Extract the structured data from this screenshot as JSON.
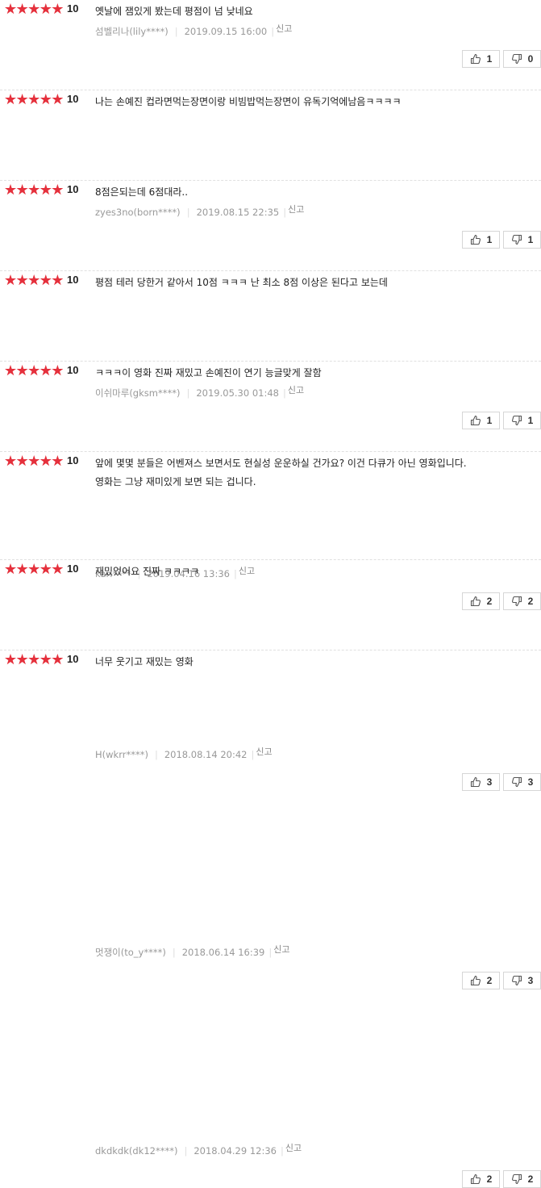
{
  "theme": {
    "star_color": "#e5303c",
    "text_color": "#222222",
    "meta_color": "#999999"
  },
  "icons": {
    "star": "star-icon",
    "like": "thumbs-up-icon",
    "dislike": "thumbs-down-icon"
  },
  "reviews": [
    {
      "rating_stars": 5,
      "score": "10",
      "lines": [
        "옛날에 잼있게 봤는데 평점이 넘 낮네요"
      ],
      "author": "섬벨리나(lily****)",
      "date": "2019.09.15 16:00",
      "report": "신고",
      "likes": "1",
      "dislikes": "0"
    },
    {
      "rating_stars": 5,
      "score": "10",
      "lines": [
        "나는 손예진 컵라면먹는장면이랑 비빔밥먹는장면이 유독기억에남음ㅋㅋㅋㅋ"
      ],
      "author": "zyes3no(born****)",
      "date": "2019.08.15 22:35",
      "report": "신고",
      "likes": "1",
      "dislikes": "1"
    },
    {
      "rating_stars": 5,
      "score": "10",
      "lines": [
        "8점은되는데 6점대라.."
      ],
      "author": "이쉬마루(gksm****)",
      "date": "2019.05.30 01:48",
      "report": "신고",
      "likes": "1",
      "dislikes": "1"
    },
    {
      "rating_stars": 5,
      "score": "10",
      "lines": [
        "평점 테러 당한거 같아서 10점 ㅋㅋㅋ 난 최소 8점 이상은 된다고 보는데"
      ],
      "author": "kari****",
      "date": "2019.04.16 13:36",
      "report": "신고",
      "likes": "2",
      "dislikes": "2"
    },
    {
      "rating_stars": 5,
      "score": "10",
      "lines": [
        "ㅋㅋㅋ이 영화 진짜 재밌고 손예진이 연기 능글맞게 잘함"
      ],
      "author": "H(wkrr****)",
      "date": "2018.08.14 20:42",
      "report": "신고",
      "likes": "3",
      "dislikes": "3"
    },
    {
      "rating_stars": 5,
      "score": "10",
      "lines": [
        "앞에 몇몇 분들은 어벤져스 보면서도 현실성 운운하실 건가요? 이건 다큐가 아닌 영화입니다.",
        "영화는 그냥 재미있게 보면 되는 겁니다."
      ],
      "author": "멋쟁이(to_y****)",
      "date": "2018.06.14 16:39",
      "report": "신고",
      "likes": "2",
      "dislikes": "3"
    },
    {
      "rating_stars": 5,
      "score": "10",
      "lines": [
        "재밌었어요 진짜 ㅋㅋㅋㅋ"
      ],
      "author": "dkdkdk(dk12****)",
      "date": "2018.04.29 12:36",
      "report": "신고",
      "likes": "2",
      "dislikes": "2"
    },
    {
      "rating_stars": 5,
      "score": "10",
      "lines": [
        "너무 웃기고 재밌는 영화"
      ],
      "author": "",
      "date": "",
      "report": "",
      "likes": "",
      "dislikes": ""
    }
  ]
}
